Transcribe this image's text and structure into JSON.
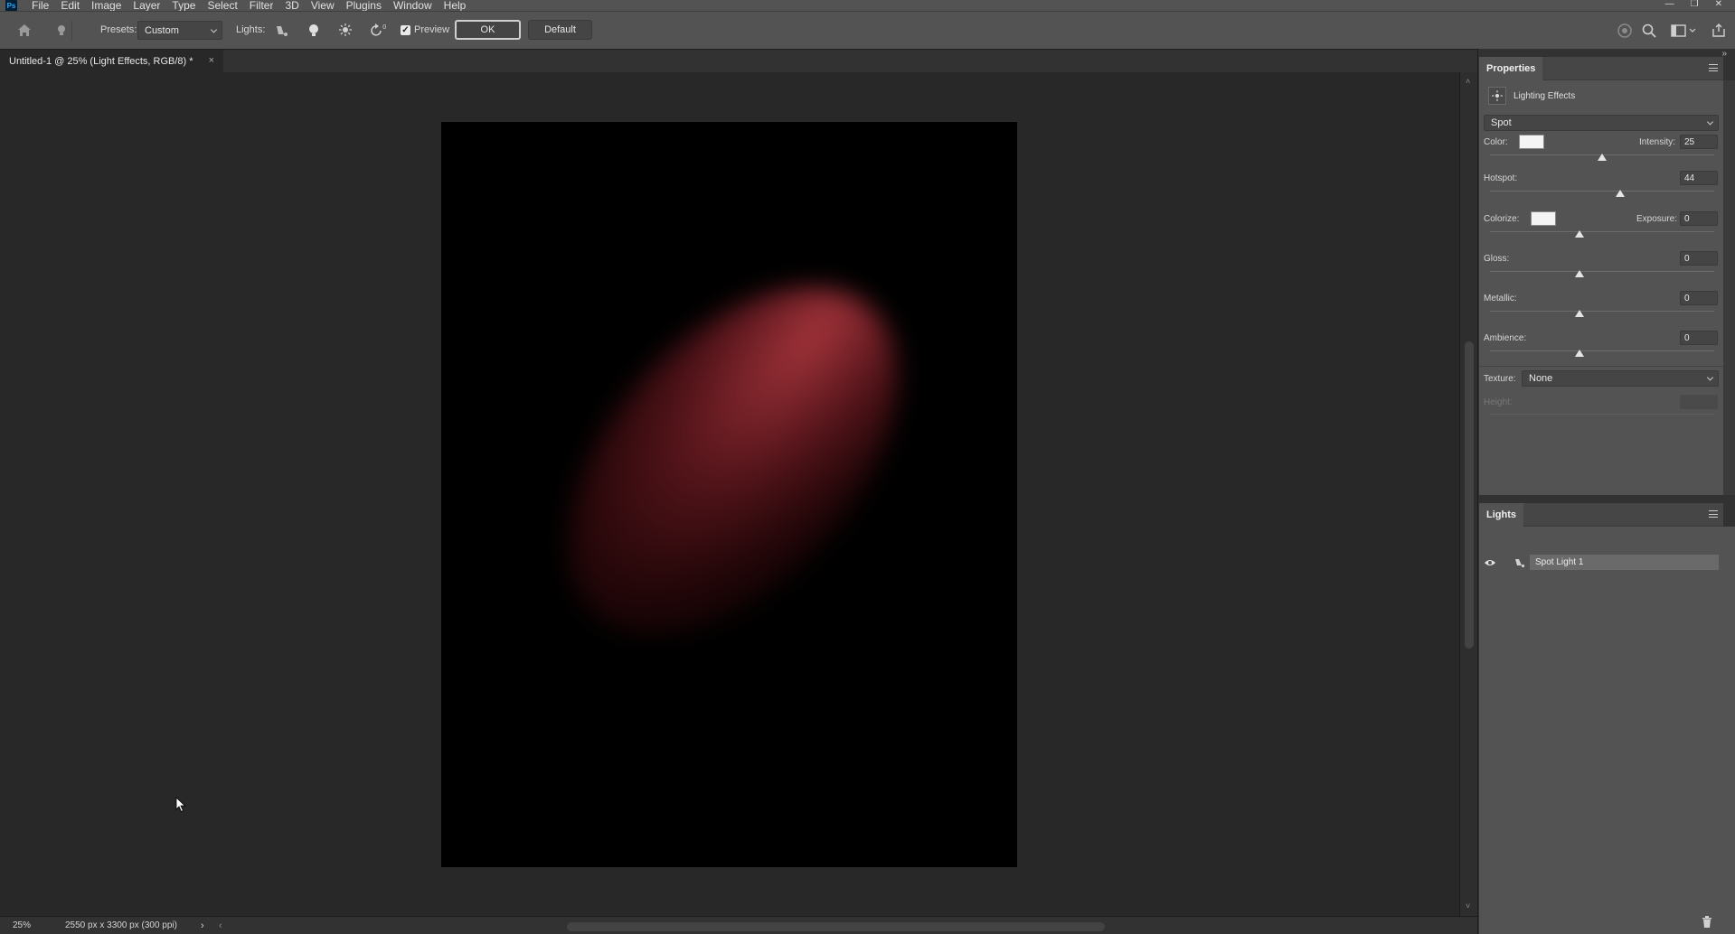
{
  "app": {
    "logo": "Ps",
    "menu": [
      "File",
      "Edit",
      "Image",
      "Layer",
      "Type",
      "Select",
      "Filter",
      "3D",
      "View",
      "Plugins",
      "Window",
      "Help"
    ],
    "window_controls": [
      "minimize-icon",
      "restore-icon",
      "close-icon"
    ]
  },
  "options_bar": {
    "presets_label": "Presets:",
    "presets_value": "Custom",
    "lights_label": "Lights:",
    "preview_label": "Preview",
    "preview_checked": true,
    "ok_label": "OK",
    "default_label": "Default",
    "icons": [
      "home-icon",
      "light-bulb-icon",
      "spot-light-icon",
      "point-light-icon",
      "infinite-light-icon",
      "reset-light-icon",
      "workspace-icon",
      "search-icon",
      "workspace-switcher-icon",
      "share-icon"
    ]
  },
  "document": {
    "tab_title": "Untitled-1 @ 25% (Light Effects, RGB/8) *",
    "close_glyph": "×",
    "background_color": "#000000",
    "light_color": "#a03339"
  },
  "status": {
    "zoom": "25%",
    "doc_size": "2550 px x 3300 px (300 ppi)",
    "arrow": "›",
    "left_arrow": "‹"
  },
  "properties": {
    "panel_title": "Properties",
    "section_title": "Lighting Effects",
    "light_type": "Spot",
    "color_label": "Color:",
    "color_value": "#f4f4f4",
    "intensity_label": "Intensity:",
    "intensity_value": "25",
    "intensity_fraction": 0.5,
    "hotspot_label": "Hotspot:",
    "hotspot_value": "44",
    "hotspot_fraction": 0.58,
    "colorize_label": "Colorize:",
    "colorize_value": "#f4f4f4",
    "exposure_label": "Exposure:",
    "exposure_value": "0",
    "exposure_fraction": 0.4,
    "gloss_label": "Gloss:",
    "gloss_value": "0",
    "gloss_fraction": 0.4,
    "metallic_label": "Metallic:",
    "metallic_value": "0",
    "metallic_fraction": 0.4,
    "ambience_label": "Ambience:",
    "ambience_value": "0",
    "ambience_fraction": 0.4,
    "texture_label": "Texture:",
    "texture_value": "None",
    "height_label": "Height:"
  },
  "lights_panel": {
    "panel_title": "Lights",
    "lights": [
      {
        "name": "Spot Light 1",
        "visible": true
      }
    ]
  }
}
